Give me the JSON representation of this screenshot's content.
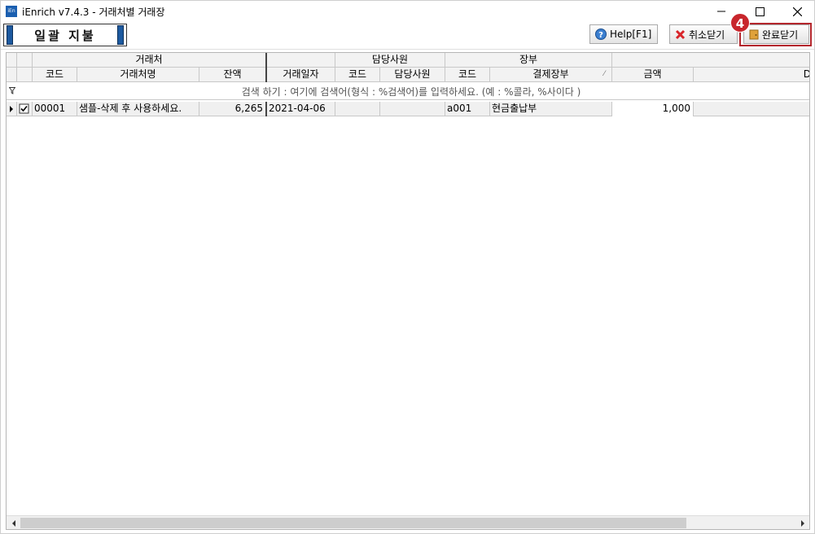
{
  "window": {
    "app_icon_text": "iEn",
    "title": "iEnrich v7.4.3 - 거래처별 거래장"
  },
  "toolbar": {
    "bulk_label": "일괄 지불",
    "help_label": "Help[F1]",
    "cancel_label": "취소닫기",
    "done_label": "완료닫기",
    "step_badge": "4"
  },
  "grid": {
    "group_headers": {
      "client": "거래처",
      "staff": "담당사원",
      "ledger": "장부"
    },
    "columns": {
      "client_code": "코드",
      "client_name": "거래처명",
      "balance": "잔액",
      "trade_date": "거래일자",
      "staff_code": "코드",
      "staff_name": "담당사원",
      "ledger_code": "코드",
      "payment_ledger": "결제장부",
      "amount": "금액",
      "next_col": "D"
    },
    "filter_hint": "검색 하기 : 여기에 검색어(형식 : %검색어)를 입력하세요. (예 : %콜라, %사이다 )",
    "rows": [
      {
        "checked": true,
        "client_code": "00001",
        "client_name": "샘플-삭제 후 사용하세요.",
        "balance": "6,265",
        "trade_date": "2021-04-06",
        "staff_code": "",
        "staff_name": "",
        "ledger_code": "a001",
        "payment_ledger": "현금출납부",
        "amount": "1,000"
      }
    ]
  }
}
